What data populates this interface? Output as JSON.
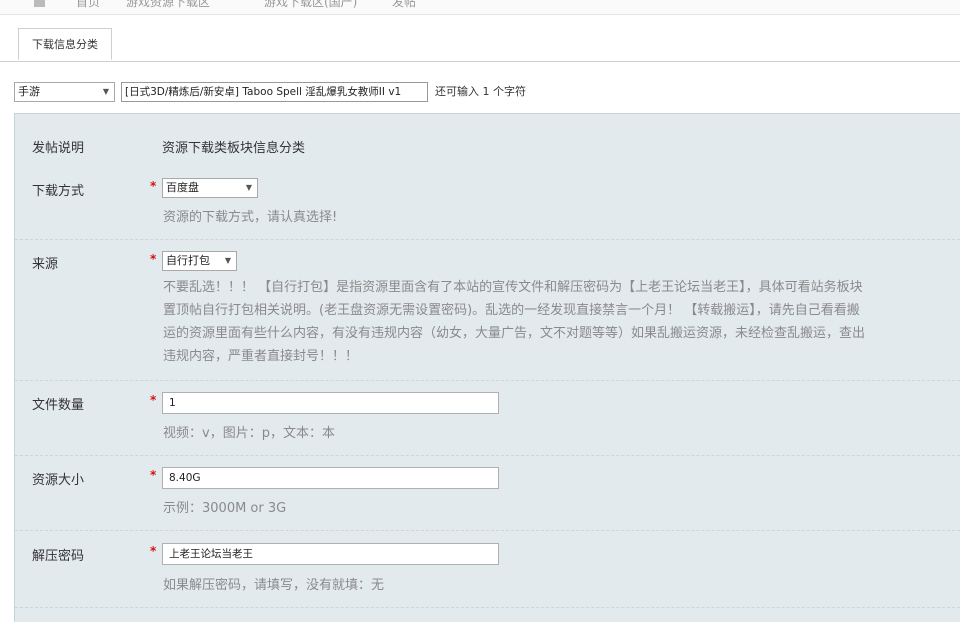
{
  "breadcrumb": {
    "items": [
      "首页",
      "游戏资源下载区",
      "游戏下载区(国产)",
      "发帖"
    ]
  },
  "tabs": [
    {
      "label": "下载信息分类",
      "active": true
    }
  ],
  "post_header": {
    "category_select": "手游",
    "title_value": "[日式3D/精炼后/新安卓] Taboo Spell 淫乱爆乳女教师II v1",
    "char_remaining": "还可输入 1 个字符"
  },
  "form": {
    "intro": {
      "label": "发帖说明",
      "text": "资源下载类板块信息分类"
    },
    "download_method": {
      "label": "下载方式",
      "value": "百度盘",
      "hint": "资源的下载方式，请认真选择!"
    },
    "source": {
      "label": "来源",
      "value": "自行打包",
      "note_lines": [
        "不要乱选！！！ 【自行打包】是指资源里面含有了本站的宣传文件和解压密码为【上老王论坛当老王】，具体可看站务板块",
        "置顶帖自行打包相关说明。(老王盘资源无需设置密码)。乱选的一经发现直接禁言一个月！ 【转载搬运】，请先自己看看搬",
        "运的资源里面有些什么内容，有没有违规内容（幼女，大量广告，文不对题等等）如果乱搬运资源，未经检查乱搬运，查出",
        "违规内容，严重者直接封号！！！"
      ]
    },
    "file_count": {
      "label": "文件数量",
      "value": "1",
      "hint": "视频：v，图片：p，文本：本"
    },
    "file_size": {
      "label": "资源大小",
      "value": "8.40G",
      "hint": "示例：3000M or 3G"
    },
    "unzip_password": {
      "label": "解压密码",
      "value": "上老王论坛当老王",
      "hint": "如果解压密码，请填写，没有就填：无"
    },
    "required_mark": "*"
  },
  "colors": {
    "panel_bg": "#e3eaee",
    "required": "#d31111",
    "hint_text": "#8a8a8a"
  }
}
